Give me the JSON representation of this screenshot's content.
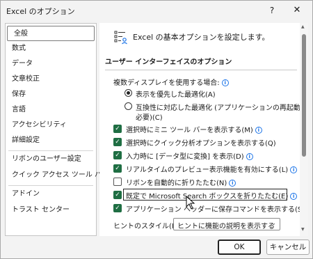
{
  "window": {
    "title": "Excel のオプション",
    "help_label": "?",
    "close_label": "✕"
  },
  "sidebar": {
    "items": [
      {
        "label": "全般"
      },
      {
        "label": "数式"
      },
      {
        "label": "データ"
      },
      {
        "label": "文章校正"
      },
      {
        "label": "保存"
      },
      {
        "label": "言語"
      },
      {
        "label": "アクセシビリティ"
      },
      {
        "label": "詳細設定"
      },
      {
        "label": "リボンのユーザー設定"
      },
      {
        "label": "クイック アクセス ツール バー"
      },
      {
        "label": "アドイン"
      },
      {
        "label": "トラスト センター"
      }
    ],
    "selected": "全般"
  },
  "main": {
    "header": "Excel の基本オプションを設定します。",
    "section_title": "ユーザー インターフェイスのオプション",
    "multi_display_label": "複数ディスプレイを使用する場合:",
    "radios": [
      {
        "label": "表示を優先した最適化(A)",
        "selected": true
      },
      {
        "label_line1": "互換性に対応した最適化 (アプリケーションの再起動が",
        "label_line2": "必要)(C)",
        "selected": false
      }
    ],
    "checkboxes": [
      {
        "label": "選択時にミニ ツール バーを表示する(M)",
        "checked": true,
        "info": true
      },
      {
        "label": "選択時にクイック分析オプションを表示する(Q)",
        "checked": true,
        "info": false
      },
      {
        "label": "入力時に [データ型に変換] を表示(D)",
        "checked": true,
        "info": true
      },
      {
        "label": "リアルタイムのプレビュー表示機能を有効にする(L)",
        "checked": true,
        "info": true
      },
      {
        "label": "リボンを自動的に折りたたむ(N)",
        "checked": false,
        "info": true
      },
      {
        "label": "既定で Microsoft Search ボックスを折りたたむ(E)",
        "checked": true,
        "info": true
      },
      {
        "label": "アプリケーション ヘッダーに保存コマンドを表示する(S)",
        "checked": true,
        "info": true
      }
    ],
    "tooltip_style": {
      "label": "ヒントのスタイル(R):",
      "value": "ヒントに機能の説明を表示する"
    }
  },
  "buttons": {
    "ok": "OK",
    "cancel": "キャンセル"
  },
  "colors": {
    "accent": "#1f6e43",
    "info": "#1a73e8"
  }
}
